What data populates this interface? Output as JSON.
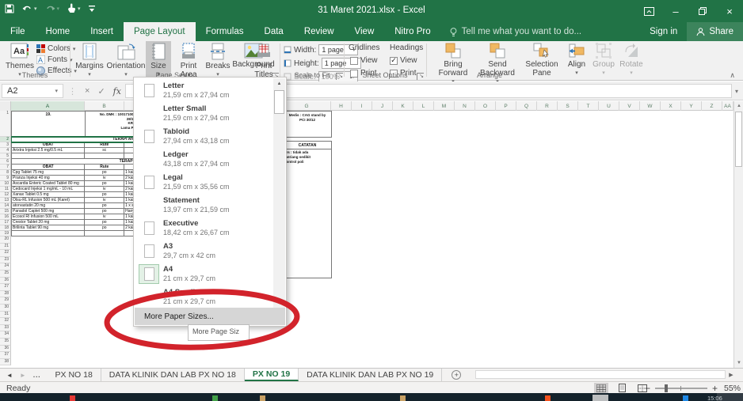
{
  "colors": {
    "accent": "#217346",
    "annotation_red": "#d2232b",
    "size_button_pressed": "#c8c8c8"
  },
  "title_bar": {
    "title": "31 Maret 2021.xlsx - Excel"
  },
  "ribbon_tabs": {
    "file": "File",
    "tabs": [
      "Home",
      "Insert",
      "Page Layout",
      "Formulas",
      "Data",
      "Review",
      "View",
      "Nitro Pro"
    ],
    "active": "Page Layout",
    "tell_me": "Tell me what you want to do...",
    "sign_in": "Sign in",
    "share": "Share"
  },
  "ribbon": {
    "themes": {
      "button": "Themes",
      "colors": "Colors",
      "fonts": "Fonts",
      "effects": "Effects",
      "group_label": "Themes"
    },
    "page_setup": {
      "margins": "Margins",
      "orientation": "Orientation",
      "size": "Size",
      "print_area": "Print Area",
      "breaks": "Breaks",
      "background": "Background",
      "print_titles": "Print Titles",
      "group_label": "Page Setup"
    },
    "scale_to_fit": {
      "width_label": "Width:",
      "width_value": "1 page",
      "height_label": "Height:",
      "height_value": "1 page",
      "scale_label": "Scale:",
      "scale_value": "100%",
      "group_label": "Scale to Fit"
    },
    "sheet_options": {
      "col1": "Gridlines",
      "col2": "Headings",
      "view": "View",
      "print": "Print",
      "gridlines_view_checked": false,
      "gridlines_print_checked": false,
      "headings_view_checked": true,
      "headings_print_checked": false,
      "group_label": "Sheet Options"
    },
    "arrange": {
      "bring_forward": "Bring Forward",
      "send_backward": "Send Backward",
      "selection_pane": "Selection Pane",
      "align": "Align",
      "group": "Group",
      "rotate": "Rotate",
      "group_label": "Arrange"
    }
  },
  "formula_bar": {
    "name_box": "A2",
    "fx": "fx"
  },
  "size_dropdown": {
    "items": [
      {
        "name": "Letter",
        "dims": "21,59 cm x 27,94 cm",
        "icon": true,
        "selected": false
      },
      {
        "name": "Letter Small",
        "dims": "21,59 cm x 27,94 cm",
        "icon": false,
        "selected": false
      },
      {
        "name": "Tabloid",
        "dims": "27,94 cm x 43,18 cm",
        "icon": true,
        "selected": false
      },
      {
        "name": "Ledger",
        "dims": "43,18 cm x 27,94 cm",
        "icon": false,
        "selected": false
      },
      {
        "name": "Legal",
        "dims": "21,59 cm x 35,56 cm",
        "icon": true,
        "selected": false
      },
      {
        "name": "Statement",
        "dims": "13,97 cm x 21,59 cm",
        "icon": false,
        "selected": false
      },
      {
        "name": "Executive",
        "dims": "18,42 cm x 26,67 cm",
        "icon": true,
        "selected": false
      },
      {
        "name": "A3",
        "dims": "29,7 cm x 42 cm",
        "icon": true,
        "selected": false
      },
      {
        "name": "A4",
        "dims": "21 cm x 29,7 cm",
        "icon": true,
        "selected": true
      },
      {
        "name": "A4 Small",
        "dims": "21 cm x 29,7 cm",
        "icon": false,
        "selected": false
      }
    ],
    "more_item": "More Paper Sizes...",
    "tooltip": "More Page Siz"
  },
  "sheet": {
    "visible_columns": [
      "A",
      "B",
      "C",
      "D",
      "E",
      "F",
      "G",
      "H",
      "I",
      "J",
      "K",
      "L",
      "M",
      "N",
      "O",
      "P",
      "Q",
      "R",
      "S",
      "T",
      "U",
      "V",
      "W",
      "X",
      "Y",
      "Z",
      "AA"
    ],
    "visible_rows_max": 38,
    "selected_cell": "A2",
    "document": {
      "row1_a": "19.",
      "row1_b_lines": [
        "No. DMK : 100171005",
        "28/12",
        "KRS",
        "Lama Pe"
      ],
      "section1_title": "TERAPI AN",
      "table_headers": [
        "OBAT",
        "Rute"
      ],
      "section1_rows": [
        {
          "obat": "Arixtra Injeksi 2.5 mg/0.5 mL",
          "rute": "sc",
          "extra": ""
        }
      ],
      "section2_title": "TERAPI",
      "section2_rows": [
        {
          "obat": "Cpg Tablet 75 mg",
          "rute": "po",
          "extra": "1 kali"
        },
        {
          "obat": "Pranza Injeksi 40 mg",
          "rute": "iv",
          "extra": "2 kali"
        },
        {
          "obat": "Ascardia Enteric Coated Tablet 80 mg",
          "rute": "po",
          "extra": "1 kali"
        },
        {
          "obat": "Cedocard Injeksi 1 mg/mL - 10 mL",
          "rute": "iv",
          "extra": "2 kali"
        },
        {
          "obat": "Xanax Tablet 0.5 mg",
          "rute": "po",
          "extra": "1 kali"
        },
        {
          "obat": "Otsu-RL Infusion 500 mL (Karet)",
          "rute": "iv",
          "extra": "1 kali"
        },
        {
          "obat": "atorvastatin 20 mg",
          "rute": "po",
          "extra": "1 x se"
        },
        {
          "obat": "Panadol Caplet 500 mg",
          "rute": "po",
          "extra": "Hany"
        },
        {
          "obat": "Ecosol Rl Infusion 500 mL",
          "rute": "iv",
          "extra": "1 kali"
        },
        {
          "obat": "Crestor Tablet 20 mg",
          "rute": "po",
          "extra": "1 kali"
        },
        {
          "obat": "Brilinta Tablet 90 mg",
          "rute": "po",
          "extra": "2 kali"
        }
      ],
      "g_column": {
        "header_lines": [
          "Medis : CAG stand by",
          "PCI 30/12"
        ],
        "catatan": "CATATAN",
        "notes": [
          "krs : tidak ada",
          "meriang sedikit",
          "kontrol poli"
        ]
      }
    }
  },
  "sheet_tabs": {
    "tabs": [
      {
        "label": "PX NO 18",
        "active": false
      },
      {
        "label": "DATA KLINIK DAN LAB PX NO 18",
        "active": false
      },
      {
        "label": "PX NO 19",
        "active": true
      },
      {
        "label": "DATA KLINIK DAN LAB PX NO 19",
        "active": false
      }
    ]
  },
  "status_bar": {
    "mode": "Ready",
    "zoom": "55%"
  },
  "taskbar": {
    "clock": "15:06",
    "icon_colors": [
      "#e53935",
      "#43a047",
      "#c8a165",
      "#c8a165",
      "#f4511e",
      "#1e88e5"
    ]
  }
}
